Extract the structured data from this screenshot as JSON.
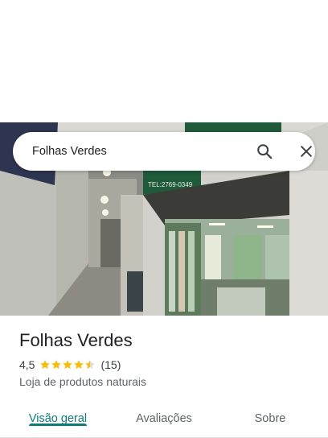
{
  "search": {
    "query": "Folhas Verdes"
  },
  "photo": {
    "sign_text": "TEL:2769-0349"
  },
  "place": {
    "name": "Folhas Verdes",
    "rating": "4,5",
    "stars": 4.5,
    "review_count": "(15)",
    "category": "Loja de produtos naturais"
  },
  "tabs": [
    {
      "label": "Visão geral",
      "active": true
    },
    {
      "label": "Avaliações",
      "active": false
    },
    {
      "label": "Sobre",
      "active": false
    }
  ],
  "colors": {
    "accent": "#0b7c78",
    "star": "#fbbc04",
    "sign": "#1f5a3a"
  },
  "icons": {
    "search": "search-icon",
    "close": "close-icon"
  }
}
